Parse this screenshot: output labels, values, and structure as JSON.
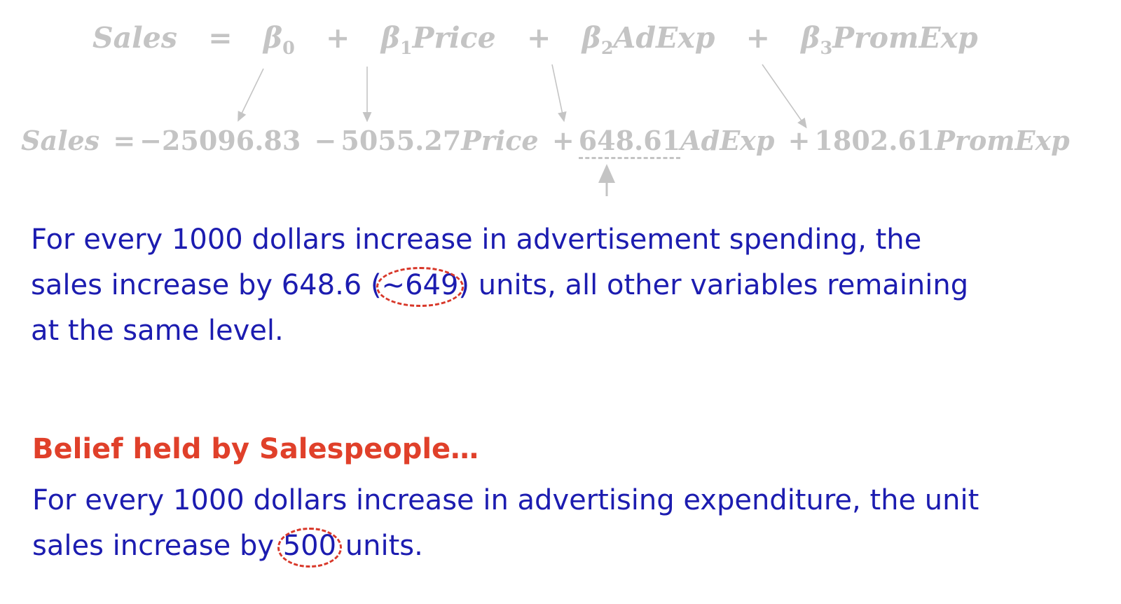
{
  "general_model": {
    "lhs": "Sales",
    "eq": "=",
    "beta": "β",
    "b0_sub": "0",
    "b1_sub": "1",
    "b2_sub": "2",
    "b3_sub": "3",
    "plus": "+",
    "var1": "Price",
    "var2": "AdExp",
    "var3": "PromExp"
  },
  "fitted_model": {
    "lhs": "Sales",
    "eq": "=",
    "intercept": "−25096.83",
    "op1": "−",
    "coef1": "5055.27",
    "var1": "Price",
    "op2": "+",
    "coef2": "648.61",
    "var2": "AdExp",
    "op3": "+",
    "coef3": "1802.61",
    "var3": "PromExp"
  },
  "interpretation": {
    "line1": "For every 1000 dollars increase in advertisement spending, the",
    "line2_before": "sales increase by 648.6 (",
    "line2_circled": "~649",
    "line2_after": ") units, all other variables remaining",
    "line3": "at the same level."
  },
  "belief": {
    "heading": "Belief held by Salespeople…",
    "line1": "For every 1000 dollars increase in advertising expenditure, the unit",
    "line2_before": "sales increase by ",
    "line2_circled": "500",
    "line2_after": " units."
  },
  "colors": {
    "body_text": "#1c1cb0",
    "heading": "#e0402a",
    "circle": "#d8382a",
    "equation": "#c4c4c4"
  }
}
